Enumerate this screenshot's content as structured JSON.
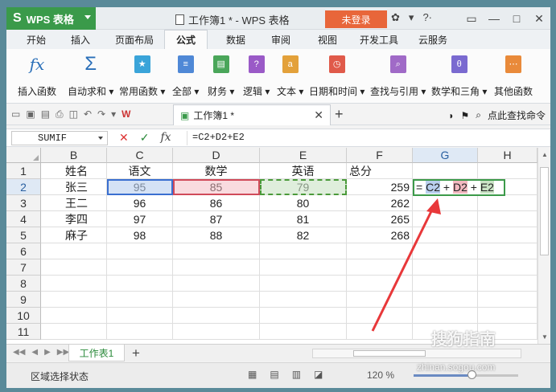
{
  "app": {
    "name": "WPS 表格",
    "title": "工作簿1 * - WPS 表格",
    "login": "未登录",
    "icons": [
      "skin-icon",
      "shirt-icon",
      "help-icon",
      "minimize-window-icon",
      "restore-icon",
      "maximize-icon",
      "close-icon"
    ]
  },
  "tabs": [
    "开始",
    "插入",
    "页面布局",
    "公式",
    "数据",
    "审阅",
    "视图",
    "开发工具",
    "云服务"
  ],
  "active_tab": "公式",
  "ribbon": [
    {
      "label": "插入函数",
      "icon": "fx"
    },
    {
      "label": "自动求和",
      "icon": "Σ"
    },
    {
      "label": "常用函数",
      "icon": "★"
    },
    {
      "label": "全部",
      "icon": "≡"
    },
    {
      "label": "财务",
      "icon": "▤"
    },
    {
      "label": "逻辑",
      "icon": "?"
    },
    {
      "label": "文本",
      "icon": "a"
    },
    {
      "label": "日期和时间",
      "icon": "◷"
    },
    {
      "label": "查找与引用",
      "icon": "⌕"
    },
    {
      "label": "数学和三角",
      "icon": "θ"
    },
    {
      "label": "其他函数",
      "icon": "⋯"
    }
  ],
  "qat": {
    "doc_tab": "工作簿1 *",
    "search": "点此查找命令"
  },
  "formula_bar": {
    "name_box": "SUMIF",
    "formula": "=C2+D2+E2"
  },
  "columns": [
    "B",
    "C",
    "D",
    "E",
    "F",
    "G",
    "H"
  ],
  "rows": [
    "1",
    "2",
    "3",
    "4",
    "5",
    "6",
    "7",
    "8",
    "9",
    "10",
    "11"
  ],
  "table": {
    "header": [
      "姓名",
      "语文",
      "数学",
      "英语",
      "总分"
    ],
    "data": [
      [
        "张三",
        "95",
        "85",
        "79",
        "259"
      ],
      [
        "王二",
        "96",
        "86",
        "80",
        "262"
      ],
      [
        "李四",
        "97",
        "87",
        "81",
        "265"
      ],
      [
        "麻子",
        "98",
        "88",
        "82",
        "268"
      ]
    ]
  },
  "edit_cell": {
    "eq": "=",
    "c2": "C2",
    "op1": "+",
    "d2": "D2",
    "op2": "+",
    "e2": "E2"
  },
  "sheet_tab": "工作表1",
  "status": {
    "text": "区域选择状态",
    "zoom": "120 %",
    "zoom_level": 0.55
  },
  "watermark": {
    "brand": "搜狗指南",
    "url": "zhinan.sogou.com"
  }
}
